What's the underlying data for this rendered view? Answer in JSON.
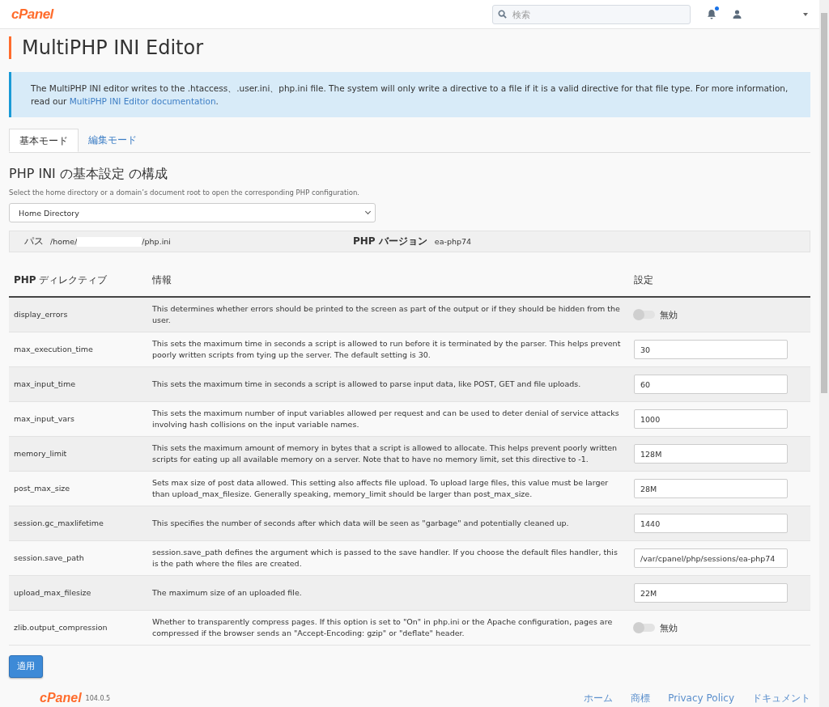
{
  "header": {
    "logo": "cPanel",
    "search": {
      "placeholder": "検索"
    },
    "notification_unread": true
  },
  "page_title": "MultiPHP INI Editor",
  "notice": {
    "text": "The MultiPHP INI editor writes to the .htaccess、.user.ini、php.ini file. The system will only write a directive to a file if it is a valid directive for that file type. For more information, read our ",
    "link": "MultiPHP INI Editor documentation",
    "end": "."
  },
  "tabs": [
    {
      "label": "基本モード",
      "selected": true
    },
    {
      "label": "編集モード",
      "selected": false
    }
  ],
  "section_title": "PHP INI の基本設定 の構成",
  "section_hint": "Select the home directory or a domain’s document root to open the corresponding PHP configuration.",
  "location_select": {
    "value": "Home Directory"
  },
  "path_bar": {
    "path_label": "パス",
    "path_start": "/home/",
    "path_end": "/php.ini",
    "version_label": "PHP バージョン",
    "version": "ea-php74"
  },
  "table": {
    "columns": [
      "**PHP** ディレクティブ",
      "情報",
      "設定"
    ],
    "rows": [
      {
        "directive": "display_errors",
        "info": "This determines whether errors should be printed to the screen as part of the output or if they should be hidden from the user.",
        "kind": "toggle",
        "on": false,
        "label": "無効"
      },
      {
        "directive": "max_execution_time",
        "info": "This sets the maximum time in seconds a script is allowed to run before it is terminated by the parser. This helps prevent poorly written scripts from tying up the server. The default setting is 30.",
        "kind": "input",
        "value": "30"
      },
      {
        "directive": "max_input_time",
        "info": "This sets the maximum time in seconds a script is allowed to parse input data, like POST, GET and file uploads.",
        "kind": "input",
        "value": "60"
      },
      {
        "directive": "max_input_vars",
        "info": "This sets the maximum number of input variables allowed per request and can be used to deter denial of service attacks involving hash collisions on the input variable names.",
        "kind": "input",
        "value": "1000"
      },
      {
        "directive": "memory_limit",
        "info": "This sets the maximum amount of memory in bytes that a script is allowed to allocate. This helps prevent poorly written scripts for eating up all available memory on a server. Note that to have no memory limit, set this directive to -1.",
        "kind": "input",
        "value": "128M"
      },
      {
        "directive": "post_max_size",
        "info": "Sets max size of post data allowed. This setting also affects file upload. To upload large files, this value must be larger than upload_max_filesize. Generally speaking, memory_limit should be larger than post_max_size.",
        "kind": "input",
        "value": "28M"
      },
      {
        "directive": "session.gc_maxlifetime",
        "info": "This specifies the number of seconds after which data will be seen as \"garbage\" and potentially cleaned up.",
        "kind": "input",
        "value": "1440"
      },
      {
        "directive": "session.save_path",
        "info": "session.save_path defines the argument which is passed to the save handler. If you choose the default files handler, this is the path where the files are created.",
        "kind": "input",
        "value": "/var/cpanel/php/sessions/ea-php74"
      },
      {
        "directive": "upload_max_filesize",
        "info": "The maximum size of an uploaded file.",
        "kind": "input",
        "value": "22M"
      },
      {
        "directive": "zlib.output_compression",
        "info": "Whether to transparently compress pages. If this option is set to \"On\" in php.ini or the Apache configuration, pages are compressed if the browser sends an \"Accept-Encoding: gzip\" or \"deflate\" header.",
        "kind": "toggle",
        "on": false,
        "label": "無効"
      }
    ]
  },
  "apply_button": "適用",
  "footer": {
    "logo": "cPanel",
    "version": "104.0.5",
    "links": [
      "ホーム",
      "商標",
      "Privacy Policy",
      "ドキュメント"
    ]
  }
}
